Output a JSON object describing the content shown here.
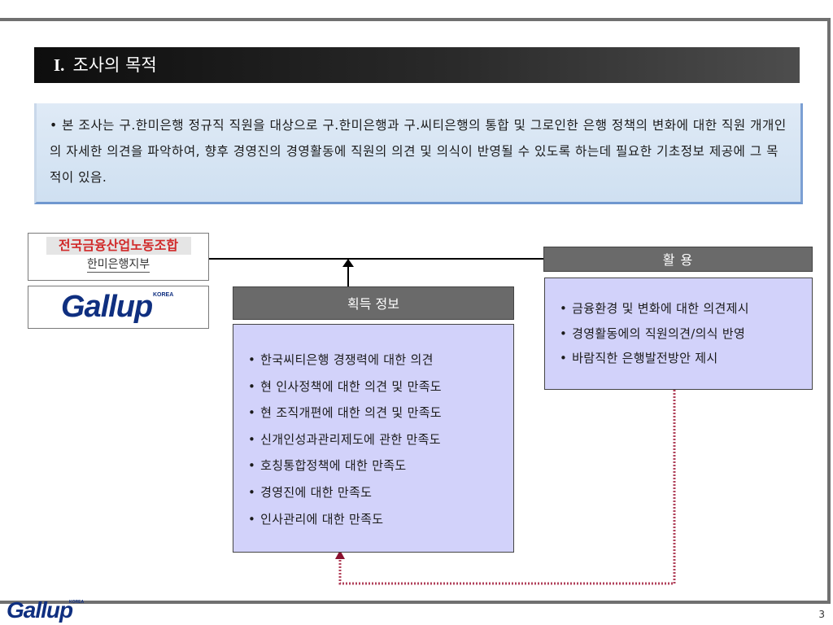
{
  "section_title": {
    "numeral": "I.",
    "text": "조사의 목적"
  },
  "purpose": {
    "bullet": "•",
    "text": "본 조사는 구.한미은행 정규직 직원을 대상으로 구.한미은행과 구.씨티은행의 통합 및 그로인한 은행 정책의 변화에 대한 직원 개개인의 자세한 의견을 파악하여, 향후 경영진의 경영활동에 직원의 의견 및 의식이 반영될 수 있도록 하는데 필요한 기초정보 제공에 그 목적이 있음."
  },
  "logos": {
    "union_name": "전국금융산업노동조합",
    "union_branch": "한미은행지부",
    "gallup_word": "Gallup",
    "gallup_korea": "KOREA"
  },
  "acquired_info": {
    "header": "획득 정보",
    "items": [
      "한국씨티은행 경쟁력에 대한 의견",
      "현 인사정책에 대한 의견 및 만족도",
      "현 조직개편에 대한 의견 및 만족도",
      "신개인성과관리제도에 관한 만족도",
      "호칭통합정책에 대한 만족도",
      "경영진에 대한 만족도",
      "인사관리에 대한 만족도"
    ]
  },
  "utilization": {
    "header": "활    용",
    "items": [
      "금융환경 및 변화에 대한 의견제시",
      "경영활동에의 직원의견/의식 반영",
      "바람직한 은행발전방안 제시"
    ]
  },
  "colors": {
    "title_bar": "#0d0d0d",
    "purpose_bg": "#dfeaf6",
    "box_fill": "#d2d2fa",
    "header_fill": "#6a6a6a",
    "feedback_line": "#b0405a",
    "logo_red": "#d12a2a",
    "logo_blue": "#0f2f80"
  },
  "footer": {
    "page_number": "3"
  }
}
